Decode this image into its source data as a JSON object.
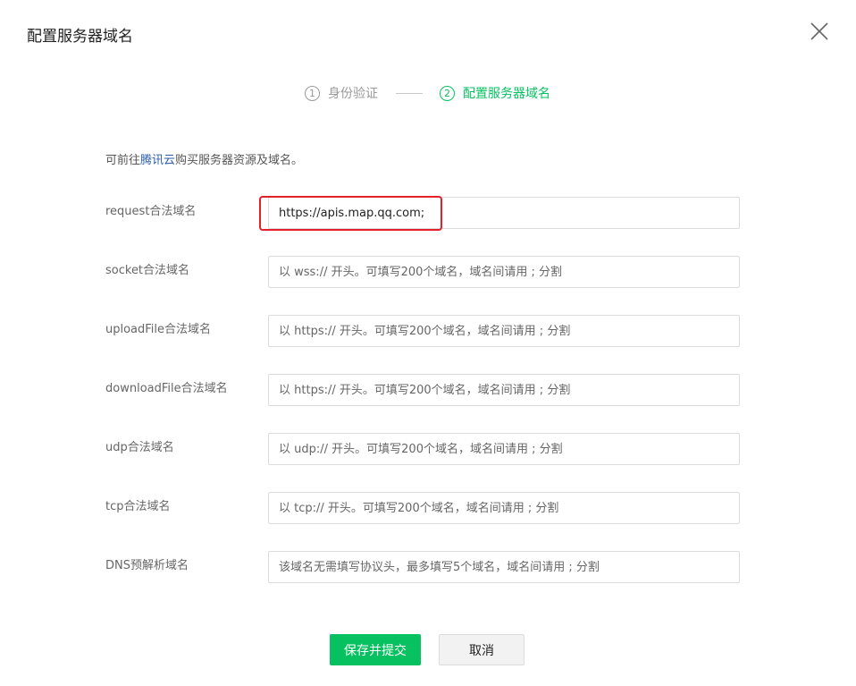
{
  "dialog": {
    "title": "配置服务器域名"
  },
  "steps": [
    {
      "number": "1",
      "label": "身份验证",
      "active": false
    },
    {
      "number": "2",
      "label": "配置服务器域名",
      "active": true
    }
  ],
  "intro": {
    "prefix": "可前往",
    "link": "腾讯云",
    "suffix": "购买服务器资源及域名。"
  },
  "fields": [
    {
      "label": "request合法域名",
      "value": "https://apis.map.qq.com;",
      "placeholder": ""
    },
    {
      "label": "socket合法域名",
      "value": "",
      "placeholder": "以 wss:// 开头。可填写200个域名，域名间请用 ; 分割"
    },
    {
      "label": "uploadFile合法域名",
      "value": "",
      "placeholder": "以 https:// 开头。可填写200个域名，域名间请用 ; 分割"
    },
    {
      "label": "downloadFile合法域名",
      "value": "",
      "placeholder": "以 https:// 开头。可填写200个域名，域名间请用 ; 分割"
    },
    {
      "label": "udp合法域名",
      "value": "",
      "placeholder": "以 udp:// 开头。可填写200个域名，域名间请用 ; 分割"
    },
    {
      "label": "tcp合法域名",
      "value": "",
      "placeholder": "以 tcp:// 开头。可填写200个域名，域名间请用 ; 分割"
    },
    {
      "label": "DNS预解析域名",
      "value": "",
      "placeholder": "该域名无需填写协议头，最多填写5个域名，域名间请用 ; 分割"
    }
  ],
  "buttons": {
    "submit": "保存并提交",
    "cancel": "取消"
  },
  "colors": {
    "accent": "#07c160",
    "link": "#2c5ea8",
    "highlight": "#e5202a"
  },
  "icons": {
    "close": "close-icon"
  }
}
